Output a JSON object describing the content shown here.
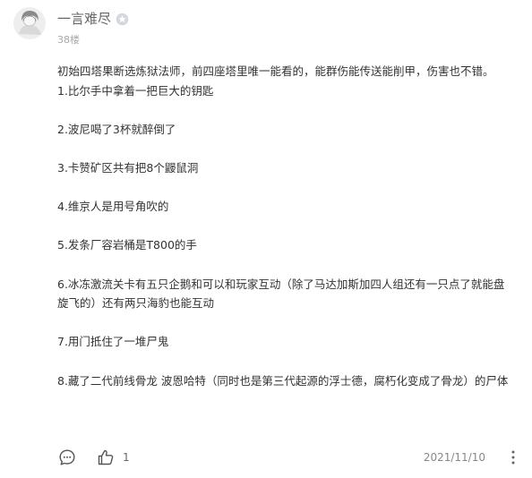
{
  "post": {
    "username": "一言难尽",
    "level_badge_icon": "level-badge-icon",
    "floor": "38楼",
    "paragraphs": [
      "初始四塔果断选炼狱法师，前四座塔里唯一能看的，能群伤能传送能削甲，伤害也不错。",
      "1.比尔手中拿着一把巨大的钥匙",
      "",
      "2.波尼喝了3杯就醉倒了",
      "",
      "3.卡赞矿区共有把8个鼹鼠洞",
      "",
      "4.维京人是用号角吹的",
      "",
      "5.发条厂容岩桶是T800的手",
      "",
      "6.冰冻激流关卡有五只企鹅和可以和玩家互动（除了马达加斯加四人组还有一只点了就能盘旋飞的）还有两只海豹也能互动",
      "",
      "7.用门抵住了一堆尸鬼",
      "",
      "8.藏了二代前线骨龙 波恩哈特（同时也是第三代起源的浮士德，腐朽化变成了骨龙）的尸体"
    ],
    "like_count": "1",
    "date": "2021/11/10"
  },
  "icons": {
    "comment": "comment-icon",
    "like": "thumbs-up-icon",
    "more": "more-vertical-icon"
  },
  "colors": {
    "text": "#333333",
    "meta": "#aaaaaa",
    "icon": "#555555",
    "date": "#888888"
  }
}
